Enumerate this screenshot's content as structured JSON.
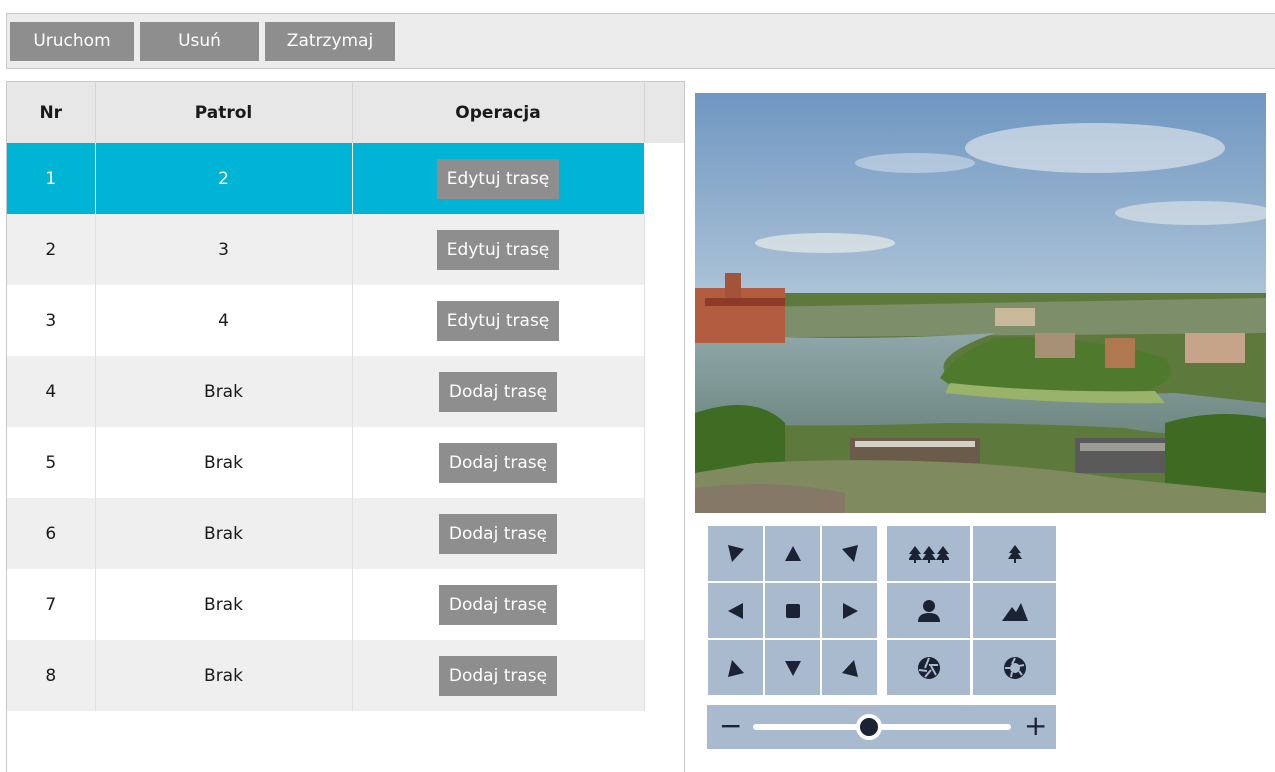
{
  "toolbar": {
    "start_label": "Uruchom",
    "delete_label": "Usuń",
    "stop_label": "Zatrzymaj"
  },
  "table": {
    "headers": [
      "Nr",
      "Patrol",
      "Operacja"
    ],
    "rows": [
      {
        "nr": "1",
        "patrol": "2",
        "action": "Edytuj trasę",
        "selected": true
      },
      {
        "nr": "2",
        "patrol": "3",
        "action": "Edytuj trasę"
      },
      {
        "nr": "3",
        "patrol": "4",
        "action": "Edytuj trasę"
      },
      {
        "nr": "4",
        "patrol": "Brak",
        "action": "Dodaj trasę"
      },
      {
        "nr": "5",
        "patrol": "Brak",
        "action": "Dodaj trasę"
      },
      {
        "nr": "6",
        "patrol": "Brak",
        "action": "Dodaj trasę"
      },
      {
        "nr": "7",
        "patrol": "Brak",
        "action": "Dodaj trasę"
      },
      {
        "nr": "8",
        "patrol": "Brak",
        "action": "Dodaj trasę"
      }
    ]
  },
  "ptz": {
    "directions": [
      "up-left-arrow-icon",
      "up-arrow-icon",
      "up-right-arrow-icon",
      "left-arrow-icon",
      "stop-icon",
      "right-arrow-icon",
      "down-left-arrow-icon",
      "down-arrow-icon",
      "down-right-arrow-icon"
    ],
    "lens": [
      "zoom-out-icon",
      "zoom-in-icon",
      "focus-near-icon",
      "focus-far-icon",
      "iris-close-icon",
      "iris-open-icon"
    ],
    "speed_min_label": "−",
    "speed_max_label": "+",
    "speed_level": 0.45
  },
  "colors": {
    "accent": "#00b4d6",
    "button": "#8e8e8e",
    "pad": "#a9bacf",
    "icon": "#1a2233"
  }
}
